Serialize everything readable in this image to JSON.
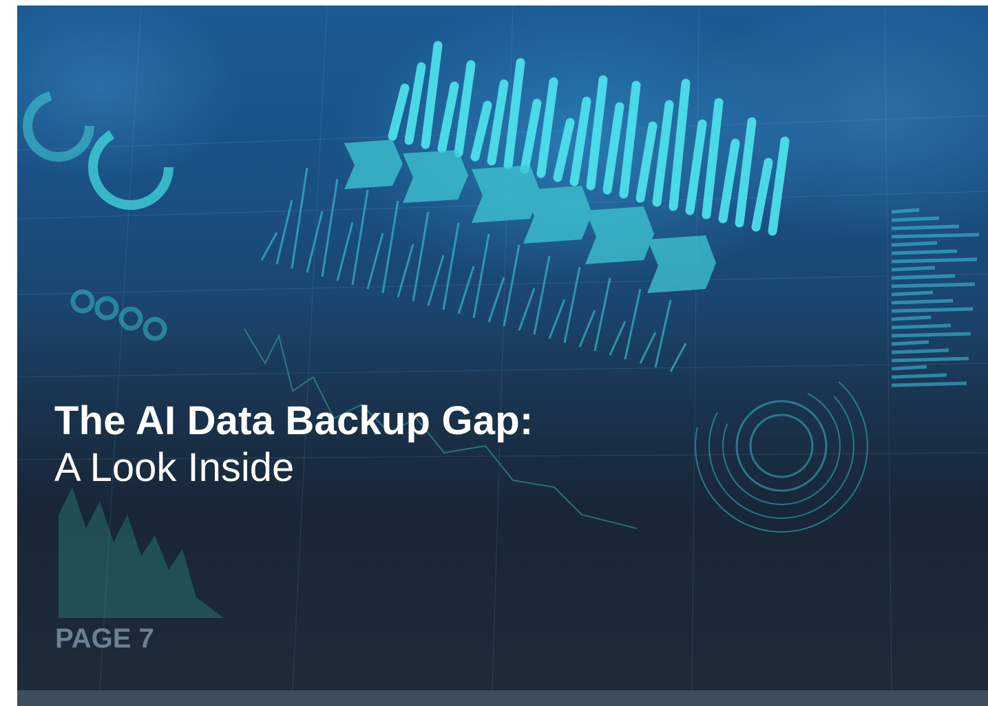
{
  "cover": {
    "title_line1": "The AI Data Backup Gap:",
    "title_line2": "A Look Inside",
    "page_label": "PAGE 7"
  },
  "background": {
    "description_icon": "data-dashboard-background",
    "colors": {
      "accent": "#38d6e6",
      "top": "#1b5a95",
      "bottom": "#1f2c3b",
      "footer_bar": "#3c4e5e",
      "page_label": "#6b8193"
    }
  }
}
